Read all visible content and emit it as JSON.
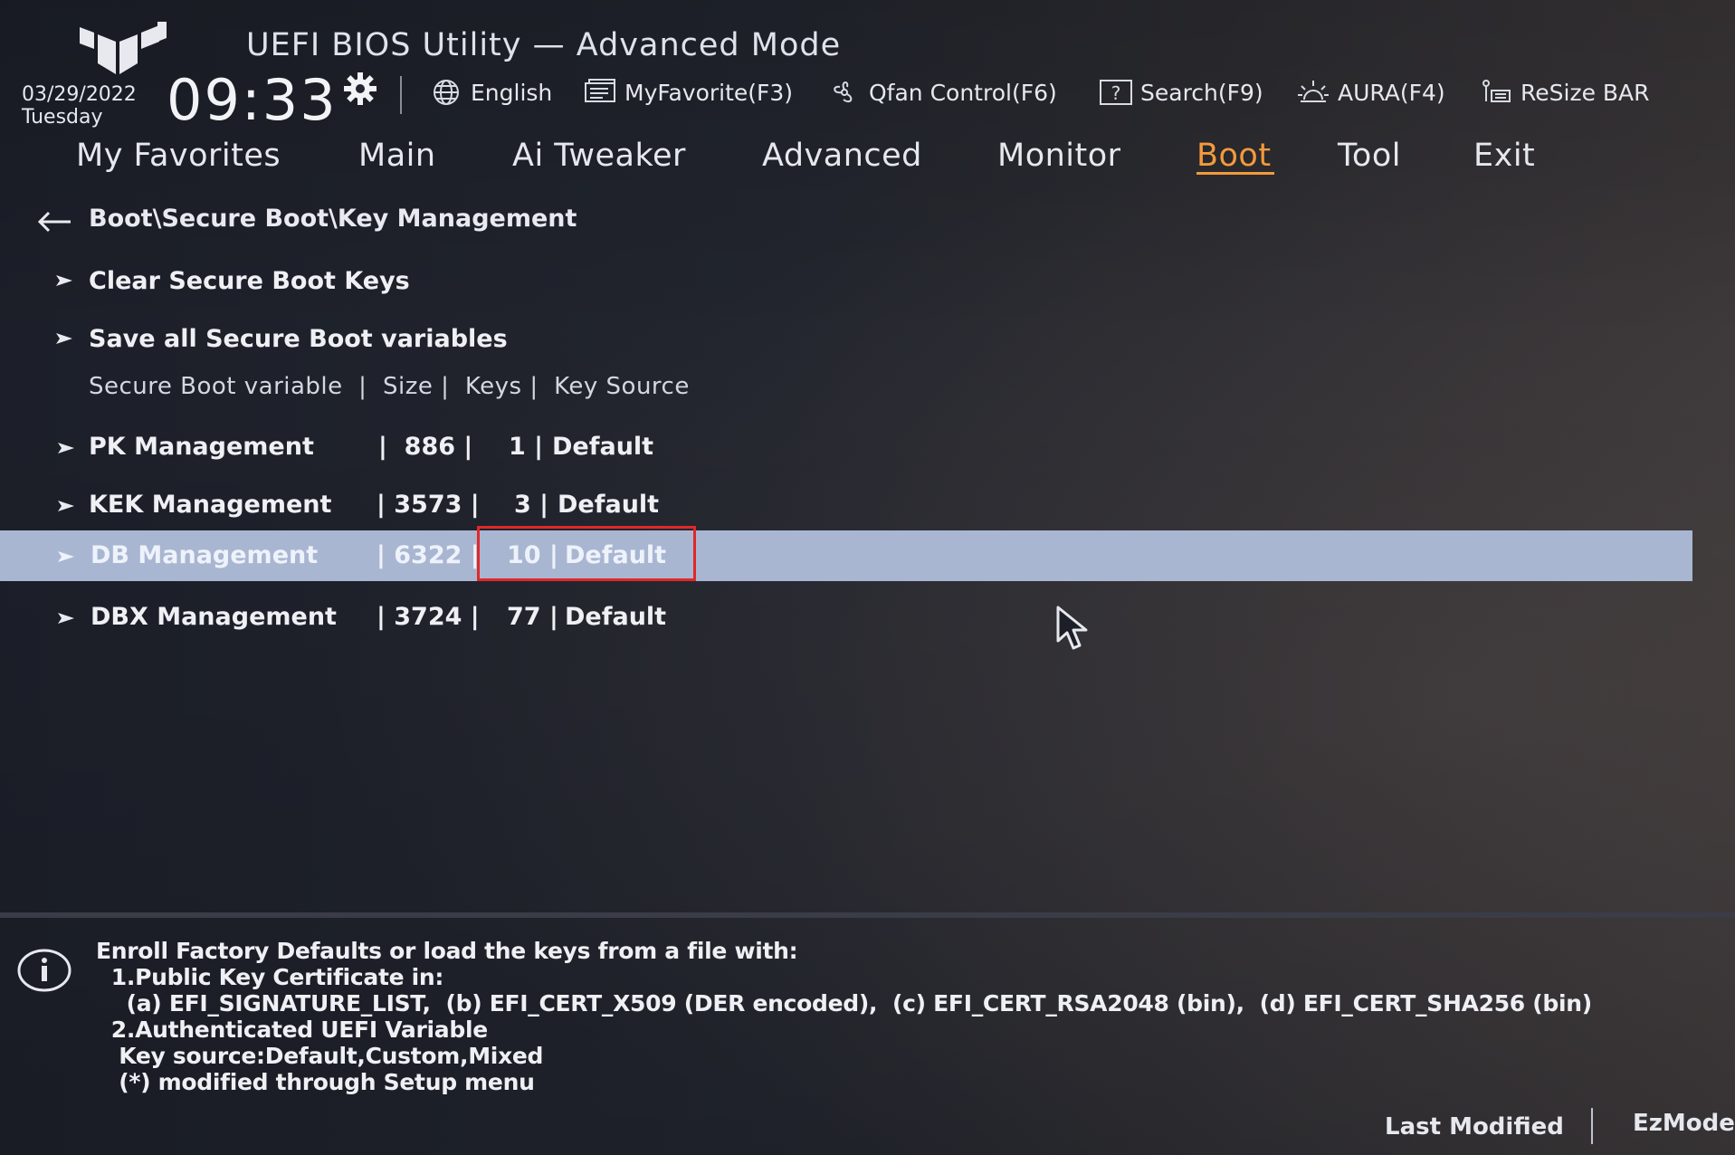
{
  "header": {
    "title": "UEFI BIOS Utility — Advanced Mode",
    "date": "03/29/2022",
    "weekday": "Tuesday",
    "time": "09:33"
  },
  "toolbar": [
    {
      "label": "English",
      "icon": "globe-icon"
    },
    {
      "label": "MyFavorite(F3)",
      "icon": "favorite-list-icon"
    },
    {
      "label": "Qfan Control(F6)",
      "icon": "fan-icon"
    },
    {
      "label": "Search(F9)",
      "icon": "search-help-icon"
    },
    {
      "label": "AURA(F4)",
      "icon": "aura-light-icon"
    },
    {
      "label": "ReSize BAR",
      "icon": "resize-bar-icon"
    }
  ],
  "nav": {
    "tabs": [
      "My Favorites",
      "Main",
      "Ai Tweaker",
      "Advanced",
      "Monitor",
      "Boot",
      "Tool",
      "Exit"
    ],
    "active": "Boot"
  },
  "breadcrumb": "Boot\\Secure Boot\\Key Management",
  "menu": {
    "actions": [
      "Clear Secure Boot Keys",
      "Save all Secure Boot variables"
    ],
    "column_header": "Secure Boot variable  |  Size |  Keys |  Key Source",
    "rows": [
      {
        "name": "PK Management",
        "size": "|  886 |",
        "keys": "1 |",
        "source": "Default"
      },
      {
        "name": "KEK Management",
        "size": "| 3573 |",
        "keys": "3 |",
        "source": "Default"
      },
      {
        "name": "DB Management",
        "size": "| 6322 |",
        "keys": "10 |",
        "source": "Default"
      },
      {
        "name": "DBX Management",
        "size": "| 3724 |",
        "keys": "77 |",
        "source": "Default"
      }
    ],
    "selected_index": 2
  },
  "help": {
    "lines": [
      "Enroll Factory Defaults or load the keys from a file with:",
      "  1.Public Key Certificate in:",
      "    (a) EFI_SIGNATURE_LIST,  (b) EFI_CERT_X509 (DER encoded),  (c) EFI_CERT_RSA2048 (bin),  (d) EFI_CERT_SHA256 (bin)",
      "  2.Authenticated UEFI Variable",
      "   Key source:Default,Custom,Mixed",
      "   (*) modified through Setup menu"
    ]
  },
  "footer": {
    "last_modified": "Last Modified",
    "ezmode": "EzMode"
  },
  "colors": {
    "accent": "#f39a3c",
    "selection": "#a9b6d2",
    "annotation_box": "#e02828"
  }
}
